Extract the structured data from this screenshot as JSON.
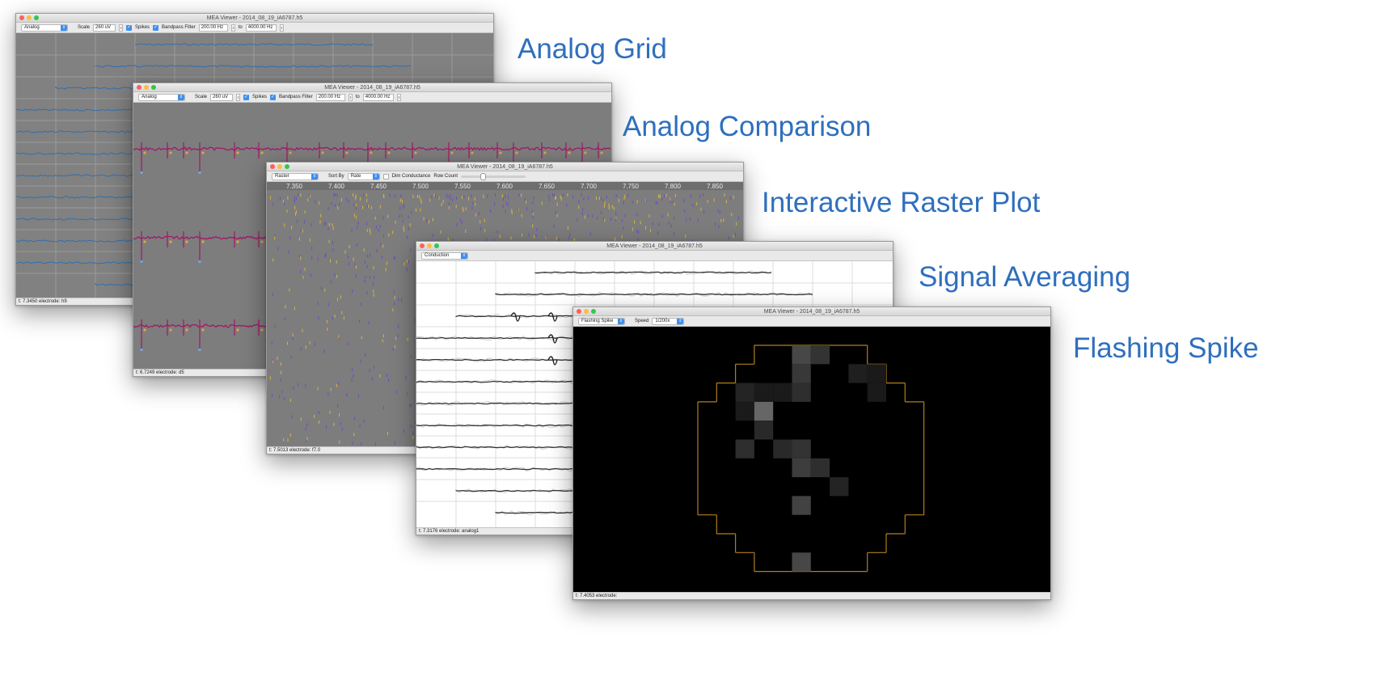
{
  "labels": {
    "analog_grid": "Analog Grid",
    "analog_comparison": "Analog Comparison",
    "interactive_raster": "Interactive Raster Plot",
    "signal_averaging": "Signal Averaging",
    "flashing_spike": "Flashing Spike"
  },
  "windows": {
    "grid": {
      "title": "MEA Viewer - 2014_08_19_iA6787.h5",
      "mode": "Analog",
      "scale_label": "Scale",
      "scale_value": "260 uV",
      "spikes_label": "Spikes",
      "bandpass_label": "Bandpass Filter",
      "low_freq": "200.00 Hz",
      "to_label": "to",
      "high_freq": "4000.00 Hz",
      "status": "t: 7.3450    electrode: h9"
    },
    "comparison": {
      "title": "MEA Viewer - 2014_08_19_iA6787.h5",
      "mode": "Analog",
      "scale_label": "Scale",
      "scale_value": "260 uV",
      "spikes_label": "Spikes",
      "bandpass_label": "Bandpass Filter",
      "low_freq": "200.00 Hz",
      "to_label": "to",
      "high_freq": "4000.00 Hz",
      "status": "t: 6.7249    electrode: d5"
    },
    "raster": {
      "title": "MEA Viewer - 2014_08_19_iA6787.h5",
      "mode": "Raster",
      "sort_label": "Sort By",
      "sort_value": "Rate",
      "dim_label": "Dim Conductance",
      "row_count_label": "Row Count",
      "axis_ticks": [
        "7.350",
        "7.400",
        "7.450",
        "7.500",
        "7.550",
        "7.600",
        "7.650",
        "7.700",
        "7.750",
        "7.800",
        "7.850"
      ],
      "status": "t: 7.5013    electrode: f7.0"
    },
    "averaging": {
      "title": "MEA Viewer - 2014_08_19_iA6787.h5",
      "mode": "Conduction",
      "status": "t: 7.3176    electrode: analog1"
    },
    "flashing": {
      "title": "MEA Viewer - 2014_08_19_iA6787.h5",
      "mode": "Flashing Spike",
      "speed_label": "Speed",
      "speed_value": "1/200x",
      "status": "t: 7.4053    electrode:"
    }
  },
  "colors": {
    "label_blue": "#2f6fbd",
    "trace_blue": "#2f6fb0",
    "trace_magenta": "#a0186a",
    "spike_orange": "#e8a23a",
    "spike_blue": "#6fa8e8",
    "raster_purple": "#6a4fbf",
    "raster_yellow": "#d9b43c",
    "array_outline": "#b07f1c"
  }
}
